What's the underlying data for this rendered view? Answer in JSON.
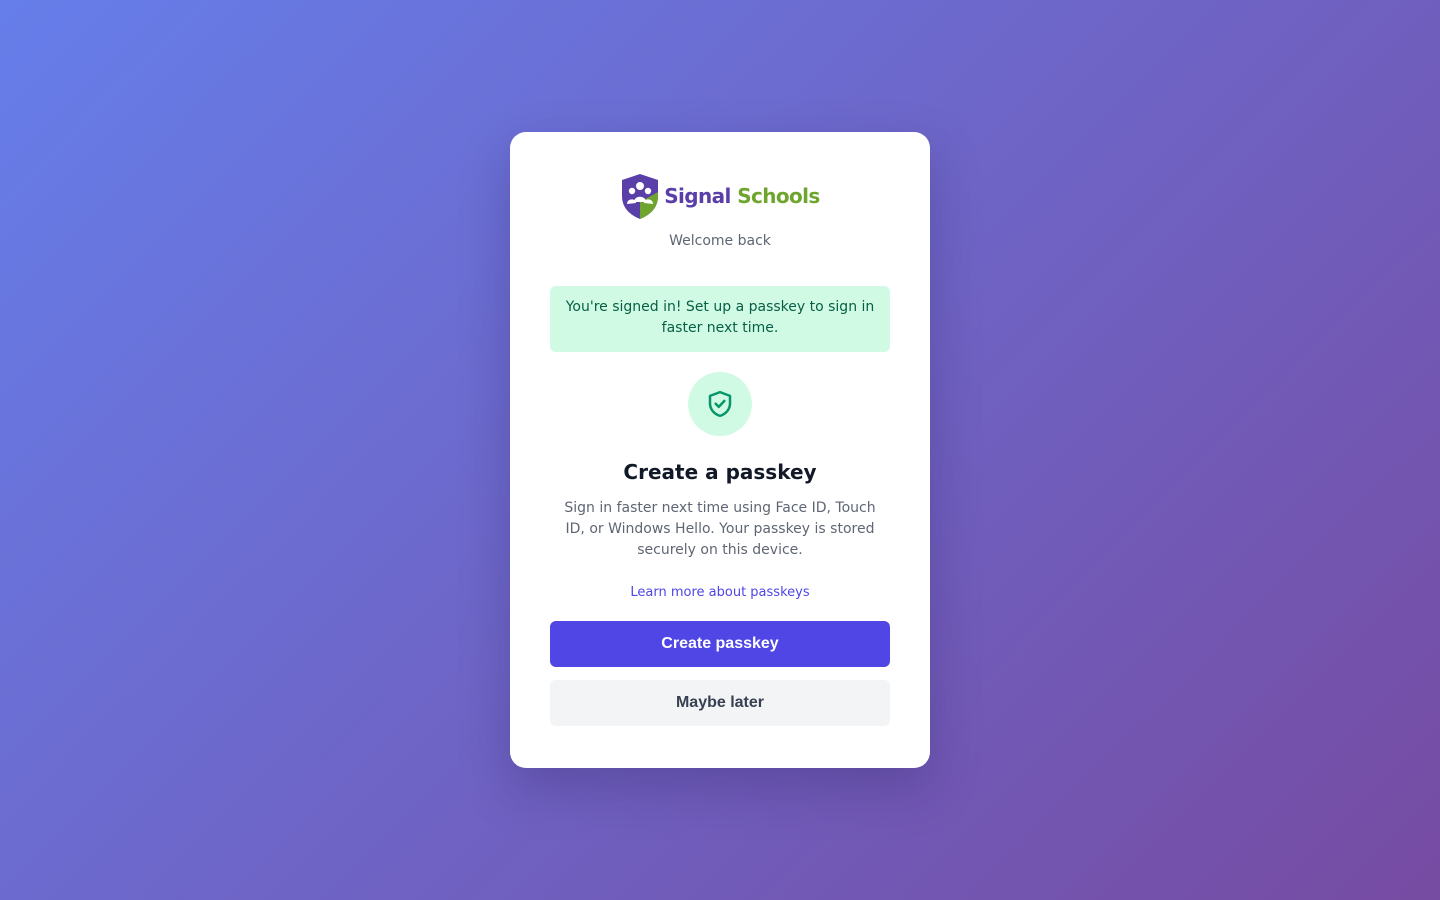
{
  "brand": {
    "name_part1": "Signal",
    "name_part2": "Schools",
    "primary_color": "#5b3fa8",
    "secondary_color": "#6fa52e",
    "logo_icon": "shield-people-logo-icon"
  },
  "subtitle": "Welcome back",
  "alert": {
    "text": "You're signed in! Set up a passkey to sign in faster next time.",
    "background": "#d1fae5",
    "color": "#065f46"
  },
  "badge_icon": "shield-check-icon",
  "heading": "Create a passkey",
  "description": "Sign in faster next time using Face ID, Touch ID, or Windows Hello. Your passkey is stored securely on this device.",
  "learn_more_link": "Learn more about passkeys",
  "buttons": {
    "primary_label": "Create passkey",
    "secondary_label": "Maybe later",
    "primary_color": "#4f46e5"
  }
}
